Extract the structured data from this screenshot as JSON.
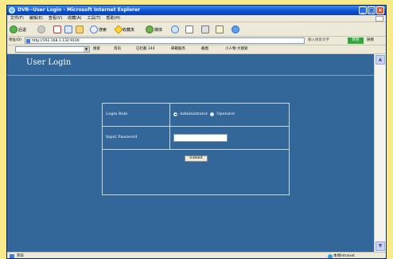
{
  "window": {
    "title": "DVR--User Login - Microsoft Internet Explorer"
  },
  "menu": [
    "文件(F)",
    "编辑(E)",
    "查看(V)",
    "收藏(A)",
    "工具(T)",
    "帮助(H)"
  ],
  "toolbar": {
    "back": "后退",
    "search": "搜索",
    "favorites": "收藏夹",
    "media": "媒体"
  },
  "address": {
    "label": "地址(D)",
    "url": "http://192.168.1.132:9100",
    "go": "转到",
    "links": "链接",
    "right_text": "输入搜索文字"
  },
  "links_bar": {
    "items": [
      "搜索",
      "资讯",
      "已拦截 144",
      "邮箱服务",
      "截图",
      "小人物-大搜索"
    ]
  },
  "page": {
    "title": "User Login",
    "role_label": "Login Role",
    "role_options": [
      "Administrator",
      "Operator"
    ],
    "selected_role": "Administrator",
    "password_label": "Input Password",
    "password_value": "",
    "submit_label": "Submit"
  },
  "status": {
    "left": "完毕",
    "right": "本地Intranet"
  },
  "colors": {
    "page_bg": "#336699",
    "frame_bg": "#f8e98a"
  }
}
